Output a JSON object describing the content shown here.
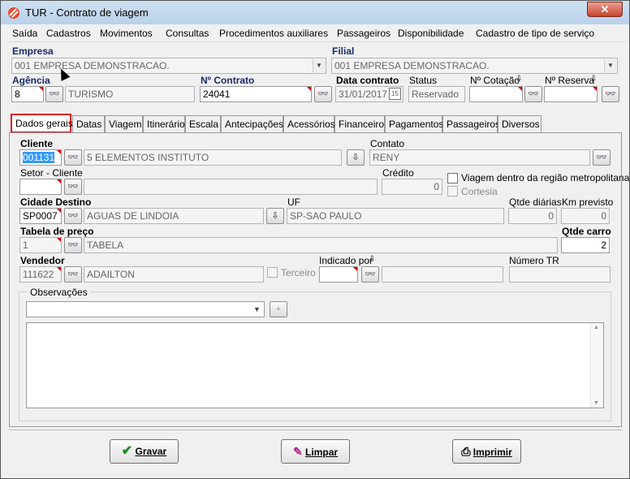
{
  "window": {
    "title": "TUR - Contrato de viagem",
    "close": "✕"
  },
  "menu": [
    "Saída",
    "Cadastros",
    "Movimentos",
    "Consultas",
    "Procedimentos auxiliares",
    "Passageiros",
    "Disponibilidade",
    "Cadastro de tipo de serviço"
  ],
  "header": {
    "empresa_label": "Empresa",
    "empresa_value": "001 EMPRESA DEMONSTRACAO.",
    "filial_label": "Filial",
    "filial_value": "001 EMPRESA DEMONSTRACAO.",
    "agencia_label": "Agência",
    "agencia_code": "8",
    "agencia_name": "TURISMO",
    "contrato_label": "Nº Contrato",
    "contrato_value": "24041",
    "data_label": "Data contrato",
    "data_value": "31/01/2017",
    "status_label": "Status",
    "status_value": "Reservado",
    "cotacao_label": "Nº Cotação",
    "cotacao_value": "",
    "reserva_label": "Nº Reserva",
    "reserva_value": ""
  },
  "tabs": [
    "Dados gerais",
    "Datas",
    "Viagem",
    "Itinerário",
    "Escala",
    "Antecipações",
    "Acessórios",
    "Financeiro",
    "Pagamentos",
    "Passageiros",
    "Diversos"
  ],
  "form": {
    "cliente_label": "Cliente",
    "cliente_code": "001131",
    "cliente_name": "5 ELEMENTOS INSTITUTO",
    "contato_label": "Contato",
    "contato_value": "RENY",
    "setor_label": "Setor - Cliente",
    "setor_code": "",
    "setor_name": "",
    "credito_label": "Crédito",
    "credito_value": "0",
    "metro_label": "Viagem dentro da região metropolitana",
    "cortesia_label": "Cortesia",
    "cidade_label": "Cidade Destino",
    "cidade_code": "SP0007",
    "cidade_name": "AGUAS DE LINDOIA",
    "uf_label": "UF",
    "uf_value": "SP-SAO PAULO",
    "qtde_diarias_label": "Qtde diárias",
    "qtde_diarias_value": "0",
    "km_label": "Km previsto",
    "km_value": "0",
    "tabela_label": "Tabela de preço",
    "tabela_code": "1",
    "tabela_name": "TABELA",
    "qtde_carro_label": "Qtde carro",
    "qtde_carro_value": "2",
    "vendedor_label": "Vendedor",
    "vendedor_code": "111622",
    "vendedor_name": "ADAILTON",
    "terceiro_label": "Terceiro",
    "indicado_label": "Indicado por",
    "indicado_code": "",
    "indicado_name": "",
    "numero_tr_label": "Número TR",
    "numero_tr_value": "",
    "obs_label": "Observações",
    "obs_select": "",
    "obs_text": ""
  },
  "buttons": {
    "gravar": "Gravar",
    "limpar": "Limpar",
    "imprimir": "Imprimir"
  },
  "colors": {
    "title_bg": "#b9d1ea",
    "selected_field": "#3399ff",
    "required_corner": "#dd0000",
    "label_navy": "#1b2a6b"
  }
}
